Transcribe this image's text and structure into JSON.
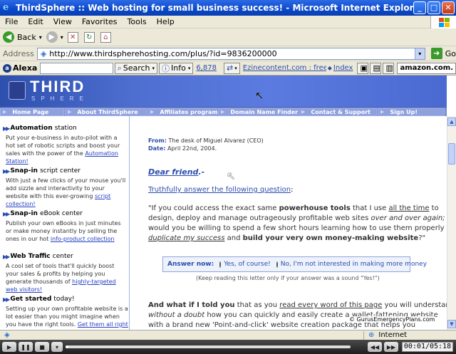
{
  "window": {
    "title": "ThirdSphere :: Web hosting for small business success! - Microsoft Internet Explorer",
    "minimize": "_",
    "maximize": "□",
    "close": "✕"
  },
  "menu": [
    "File",
    "Edit",
    "View",
    "Favorites",
    "Tools",
    "Help"
  ],
  "toolbar": {
    "back_label": "Back"
  },
  "address": {
    "label": "Address",
    "url": "http://www.thirdspherehosting.com/plus/?id=9836200000",
    "go_label": "Go"
  },
  "alexa": {
    "brand": "Alexa",
    "search_label": "Search",
    "info_label": "Info",
    "rank": "6,878",
    "site_link": "Ezinecontent.com : free Content...",
    "index_label": "Index",
    "amazon_label": "amazon.com."
  },
  "site": {
    "logo_top": "THIRD",
    "logo_bottom": "SPHERE",
    "nav": [
      "Home Page",
      "About ThirdSphere",
      "Affiliates program",
      "Domain Name Finder",
      "Contact & Support",
      "Sign Up!"
    ]
  },
  "sidebar": {
    "items": [
      {
        "title": "Automation",
        "suffix": "station",
        "body": "Put your e-business in auto-pilot with a hot set of robotic scripts and boost your sales with the power of the",
        "link": "Automation Station!"
      },
      {
        "title": "Snap-in",
        "suffix": "script center",
        "body": "With just a few clicks of your mouse you'll add sizzle and interactivity to your website with this ever-growing",
        "link": "script collection!"
      },
      {
        "title": "Snap-in",
        "suffix": "eBook center",
        "body": "Publish your own eBooks in just minutes or make money instantly by selling the ones in our hot",
        "link": "info-product collection"
      },
      {
        "title": "Web Traffic",
        "suffix": "center",
        "body": "A cool set of tools that'll quickly boost your sales & profits by helping you generate thousands of",
        "link": "highly-targeted web visitors!"
      },
      {
        "title": "Get started",
        "suffix": "today!",
        "body": "Setting up your own profitable website is a lot easier than you might imagine when you have the right tools.",
        "link": "Get them all right now!"
      }
    ]
  },
  "letter": {
    "from_label": "From:",
    "from_value": "The desk of Miguel Alvarez (CEO)",
    "date_label": "Date:",
    "date_value": "April 22nd, 2004.",
    "greeting": "Dear friend",
    "greeting_punct": ".-",
    "prompt_link": "Truthfully answer the following question",
    "prompt_colon": ":",
    "q1a": "\"If you could access the exact same ",
    "q1b": "powerhouse tools",
    "q1c": " that I use ",
    "q1d": "all the time",
    "q1e": " to",
    "q2a": "design, deploy and manage outrageously profitable web sites ",
    "q2b": "over and over again;",
    "q3": "would you be willing to spend a few short hours learning how to use them properly to",
    "q4a": "duplicate my success",
    "q4b": " and ",
    "q4c": "build your very own money-making website",
    "q4d": "?\"",
    "answer_label": "Answer now:",
    "answer_yes": "Yes, of course!",
    "answer_no": "No, I'm not interested in making more money",
    "answer_note": "(Keep reading this letter only if your answer was a sound \"Yes!\")",
    "p2a": "And what if I told you",
    "p2b": " that as you ",
    "p2c": "read every word of this page",
    "p2d": " you will understand",
    "p3a": "without a doubt",
    "p3b": " how you can quickly and easily create a wallet-fattening website",
    "p4": "with a brand new 'Point-and-click' website creation package that helps you"
  },
  "watermark": "© GurusEmergencyPlans.com",
  "status": {
    "zone": "Internet"
  },
  "media": {
    "time": "00:01/05:18",
    "progress": 0.003
  }
}
